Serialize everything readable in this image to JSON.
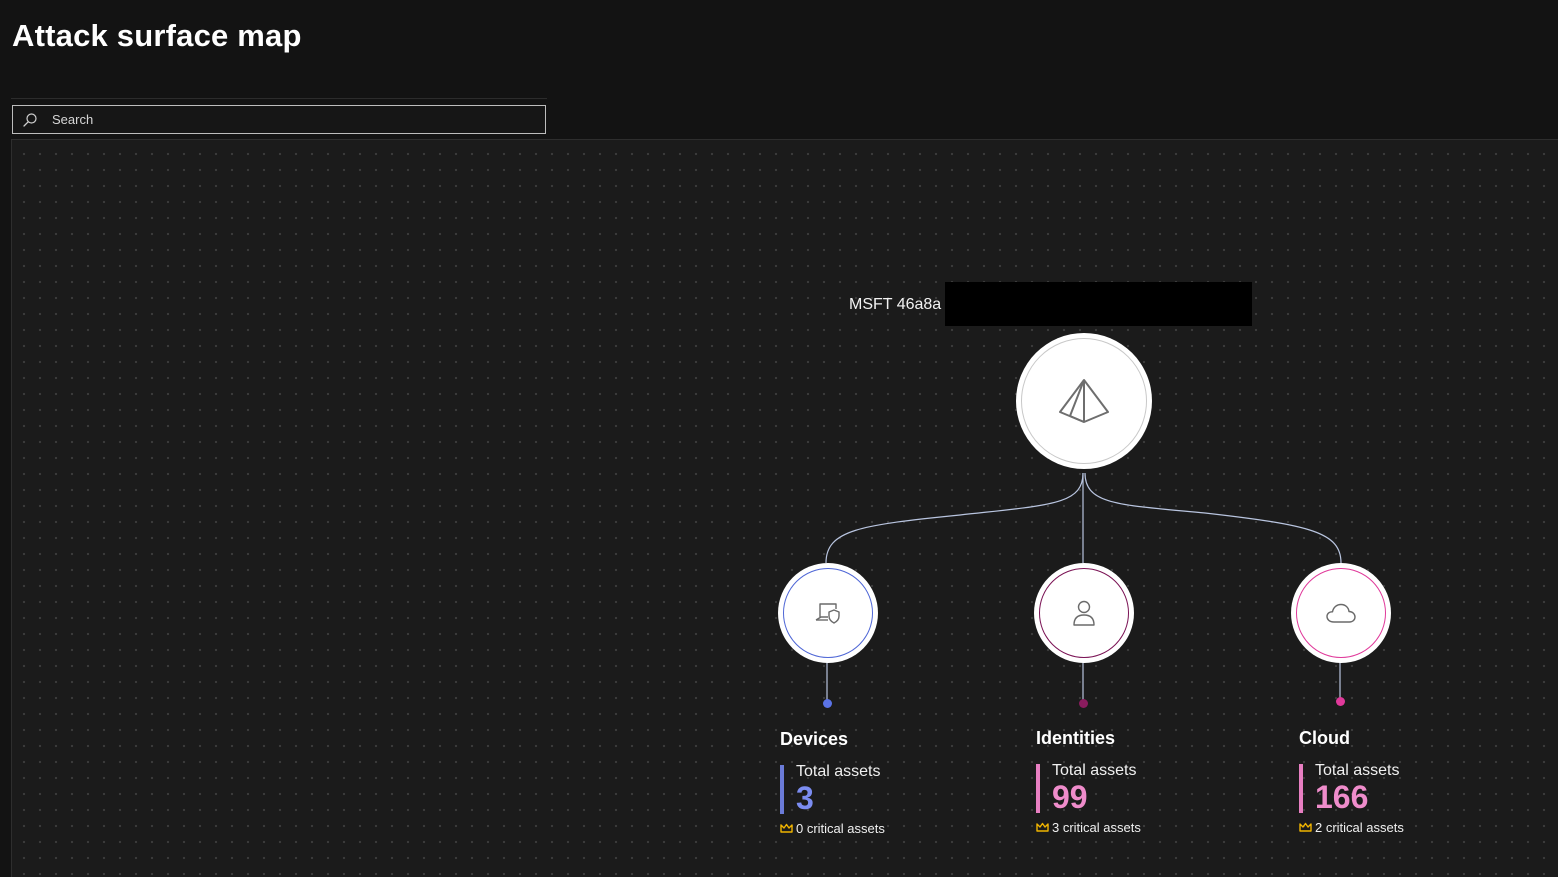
{
  "header": {
    "title": "Attack surface map"
  },
  "search": {
    "placeholder": "Search",
    "value": ""
  },
  "map": {
    "tenant_label": "MSFT 46a8a",
    "root_icon": "pyramid-icon",
    "categories": [
      {
        "name": "Devices",
        "icon": "device-shield-icon",
        "total_label": "Total assets",
        "total": "3",
        "critical_text": "0 critical assets",
        "accent": "#6b7bd8",
        "ring": "#4e66d6",
        "dot": "#5b73e6"
      },
      {
        "name": "Identities",
        "icon": "person-icon",
        "total_label": "Total assets",
        "total": "99",
        "critical_text": "3 critical assets",
        "accent": "#e87fc2",
        "ring": "#7a1254",
        "dot": "#8a1c5e"
      },
      {
        "name": "Cloud",
        "icon": "cloud-icon",
        "total_label": "Total assets",
        "total": "166",
        "critical_text": "2 critical assets",
        "accent": "#e87fc2",
        "ring": "#e0399a",
        "dot": "#e0399a"
      }
    ],
    "critical_icon": "crown-icon",
    "colors": {
      "connector": "#b9c5e0",
      "critical_icon": "#f0b400",
      "number_devices": "#7b8cf0",
      "number_pink": "#ef8ccb"
    }
  }
}
